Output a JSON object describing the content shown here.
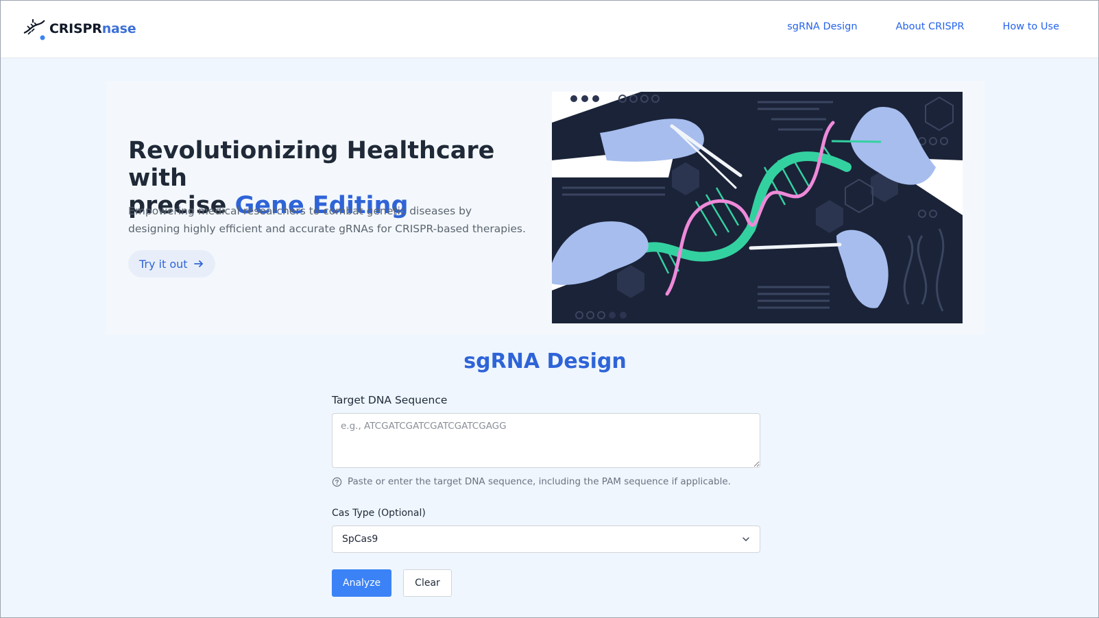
{
  "header": {
    "logo_part1": "CRISPR",
    "logo_part2": "nase",
    "nav": [
      {
        "label": "sgRNA Design"
      },
      {
        "label": "About CRISPR"
      },
      {
        "label": "How to Use"
      }
    ]
  },
  "hero": {
    "title_line1": "Revolutionizing Healthcare with",
    "title_plain": "precise ",
    "title_accent": "Gene Editing",
    "subtitle": "Empowering medical researchers to combat genetic diseases by designing highly efficient and accurate gRNAs for CRISPR-based therapies.",
    "cta_label": "Try it out"
  },
  "design": {
    "title": "sgRNA Design",
    "sequence_label": "Target DNA Sequence",
    "sequence_value": "",
    "sequence_placeholder": "e.g., ATCGATCGATCGATCGATCGAGG",
    "sequence_hint": "Paste or enter the target DNA sequence, including the PAM sequence if applicable.",
    "cas_label": "Cas Type (Optional)",
    "cas_selected": "SpCas9",
    "analyze_label": "Analyze",
    "clear_label": "Clear"
  },
  "colors": {
    "accent": "#2f64d8",
    "primary_button": "#3b82f6",
    "page_bg": "#eff6fd",
    "illustration_bg": "#1b2338",
    "dna_green": "#34d1a0",
    "dna_pink": "#ee8ad9",
    "glove_blue": "#a6bdee"
  }
}
